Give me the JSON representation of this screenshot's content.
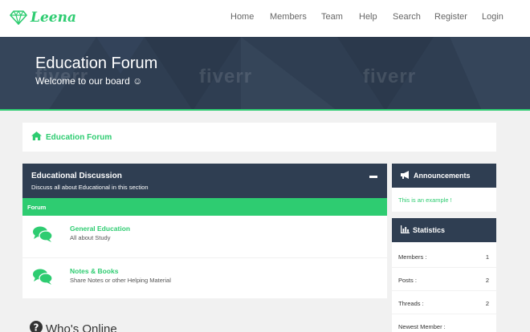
{
  "logo": {
    "text": "Leena",
    "color": "#2ecc71"
  },
  "nav": {
    "items": [
      {
        "label": "Home"
      },
      {
        "label": "Members"
      },
      {
        "label": "Team"
      },
      {
        "label": "Help"
      },
      {
        "label": "Search"
      },
      {
        "label": "Register"
      },
      {
        "label": "Login"
      }
    ]
  },
  "hero": {
    "title": "Education Forum",
    "subtitle": "Welcome to our board ☺",
    "watermark": "fiverr"
  },
  "breadcrumb": {
    "icon": "home-icon",
    "label": "Education Forum"
  },
  "category": {
    "title": "Educational Discussion",
    "description": "Discuss all about Educational in this section",
    "column_label": "Forum",
    "forums": [
      {
        "name": "General Education",
        "description": "All about Study",
        "icon": "chat-icon"
      },
      {
        "name": "Notes & Books",
        "description": "Share Notes or other Helping Material",
        "icon": "chat-icon"
      }
    ]
  },
  "online": {
    "title": "Who's Online",
    "icon": "question-circle-icon"
  },
  "sidebar": {
    "announcements": {
      "title": "Announcements",
      "icon": "bullhorn-icon",
      "text": "This is an example !"
    },
    "statistics": {
      "title": "Statistics",
      "icon": "bar-chart-icon",
      "rows": [
        {
          "label": "Members :",
          "value": "1"
        },
        {
          "label": "Posts :",
          "value": "2"
        },
        {
          "label": "Threads :",
          "value": "2"
        },
        {
          "label": "Newest Member :",
          "value": ""
        }
      ]
    }
  },
  "colors": {
    "accent": "#2ecc71",
    "dark": "#2f3e52",
    "background": "#f1f1f1"
  }
}
